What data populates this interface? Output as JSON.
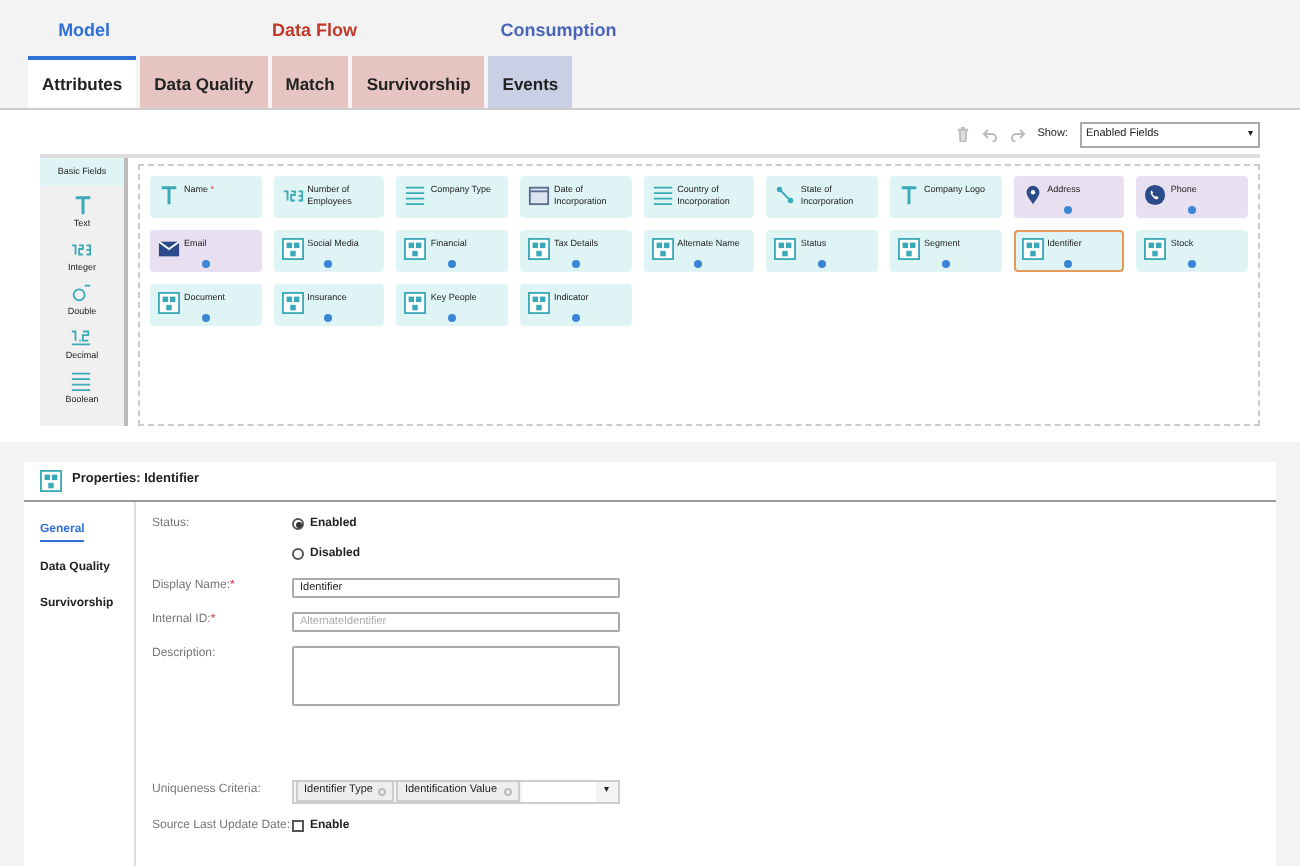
{
  "tab_groups": [
    {
      "label": "Model",
      "color": "#2f6fd6",
      "tabs": [
        {
          "label": "Attributes",
          "selected": true
        }
      ]
    },
    {
      "label": "Data Flow",
      "color": "#c0392b",
      "tabs": [
        {
          "label": "Data Quality",
          "selected": false
        },
        {
          "label": "Match",
          "selected": false
        },
        {
          "label": "Survivorship",
          "selected": false
        }
      ]
    },
    {
      "label": "Consumption",
      "color": "#4a64b8",
      "tabs": [
        {
          "label": "Events",
          "selected": false
        }
      ]
    }
  ],
  "toolbar": {
    "show_label": "Show:",
    "show_value": "Enabled Fields",
    "caret": "▾"
  },
  "palette": {
    "title": "Basic Fields",
    "items": [
      {
        "kind": "text",
        "label": "Text"
      },
      {
        "kind": "number",
        "label": "Integer"
      },
      {
        "kind": "double",
        "label": "Double"
      },
      {
        "kind": "decimal",
        "label": "Decimal"
      },
      {
        "kind": "list",
        "label": "Boolean"
      }
    ]
  },
  "fields": [
    {
      "kind": "text",
      "label": "Name",
      "required_mark": "*",
      "color": "#dff5f5",
      "has_dot": false,
      "selected": false
    },
    {
      "kind": "number",
      "label": "Number of Employees",
      "color": "#dff5f5",
      "has_dot": false,
      "selected": false
    },
    {
      "kind": "list",
      "label": "Company Type",
      "color": "#dff5f5",
      "has_dot": false,
      "selected": false
    },
    {
      "kind": "date",
      "label": "Date of Incorporation",
      "color": "#dff5f5",
      "has_dot": false,
      "selected": false
    },
    {
      "kind": "list",
      "label": "Country of Incorporation",
      "color": "#dff5f5",
      "has_dot": false,
      "selected": false
    },
    {
      "kind": "link",
      "label": "State of Incorporation",
      "color": "#dff5f5",
      "has_dot": false,
      "selected": false
    },
    {
      "kind": "text",
      "label": "Company Logo",
      "color": "#dff5f5",
      "has_dot": false,
      "selected": false
    },
    {
      "kind": "location",
      "label": "Address",
      "color": "#e8e0f0",
      "has_dot": true,
      "selected": false
    },
    {
      "kind": "phone",
      "label": "Phone",
      "color": "#e8e0f0",
      "has_dot": true,
      "selected": false
    },
    {
      "kind": "email",
      "label": "Email",
      "color": "#e8e0f0",
      "has_dot": true,
      "selected": false
    },
    {
      "kind": "group",
      "label": "Social Media",
      "color": "#dff5f5",
      "has_dot": true,
      "selected": false
    },
    {
      "kind": "group",
      "label": "Financial",
      "color": "#dff5f5",
      "has_dot": true,
      "selected": false
    },
    {
      "kind": "group",
      "label": "Tax Details",
      "color": "#dff5f5",
      "has_dot": true,
      "selected": false
    },
    {
      "kind": "group",
      "label": "Alternate Name",
      "color": "#dff5f5",
      "has_dot": true,
      "selected": false
    },
    {
      "kind": "group",
      "label": "Status",
      "color": "#dff5f5",
      "has_dot": true,
      "selected": false
    },
    {
      "kind": "group",
      "label": "Segment",
      "color": "#dff5f5",
      "has_dot": true,
      "selected": false
    },
    {
      "kind": "group",
      "label": "Identifier",
      "color": "#dff5f5",
      "has_dot": true,
      "selected": true
    },
    {
      "kind": "group",
      "label": "Stock",
      "color": "#dff5f5",
      "has_dot": true,
      "selected": false
    },
    {
      "kind": "group",
      "label": "Document",
      "color": "#dff5f5",
      "has_dot": true,
      "selected": false
    },
    {
      "kind": "group",
      "label": "Insurance",
      "color": "#dff5f5",
      "has_dot": true,
      "selected": false
    },
    {
      "kind": "group",
      "label": "Key People",
      "color": "#dff5f5",
      "has_dot": true,
      "selected": false
    },
    {
      "kind": "group",
      "label": "Indicator",
      "color": "#dff5f5",
      "has_dot": true,
      "selected": false
    }
  ],
  "properties": {
    "title": "Properties: Identifier",
    "nav": [
      {
        "label": "General",
        "selected": true
      },
      {
        "label": "Data Quality",
        "selected": false
      },
      {
        "label": "Survivorship",
        "selected": false
      }
    ],
    "status": {
      "label": "Status:",
      "options": [
        {
          "label": "Enabled",
          "selected": true
        },
        {
          "label": "Disabled",
          "selected": false
        }
      ]
    },
    "display_name": {
      "label": "Display Name:",
      "required_mark": "*",
      "value": "Identifier"
    },
    "internal_id": {
      "label": "Internal ID:",
      "required_mark": "*",
      "placeholder": "AlternateIdentifier"
    },
    "description": {
      "label": "Description:"
    },
    "uniqueness": {
      "label": "Uniqueness Criteria:",
      "tags": [
        "Identifier Type",
        "Identification Value"
      ],
      "caret": "▾"
    },
    "source_last_update": {
      "label": "Source Last Update Date:",
      "checkbox_label": "Enable",
      "checked": false
    }
  }
}
